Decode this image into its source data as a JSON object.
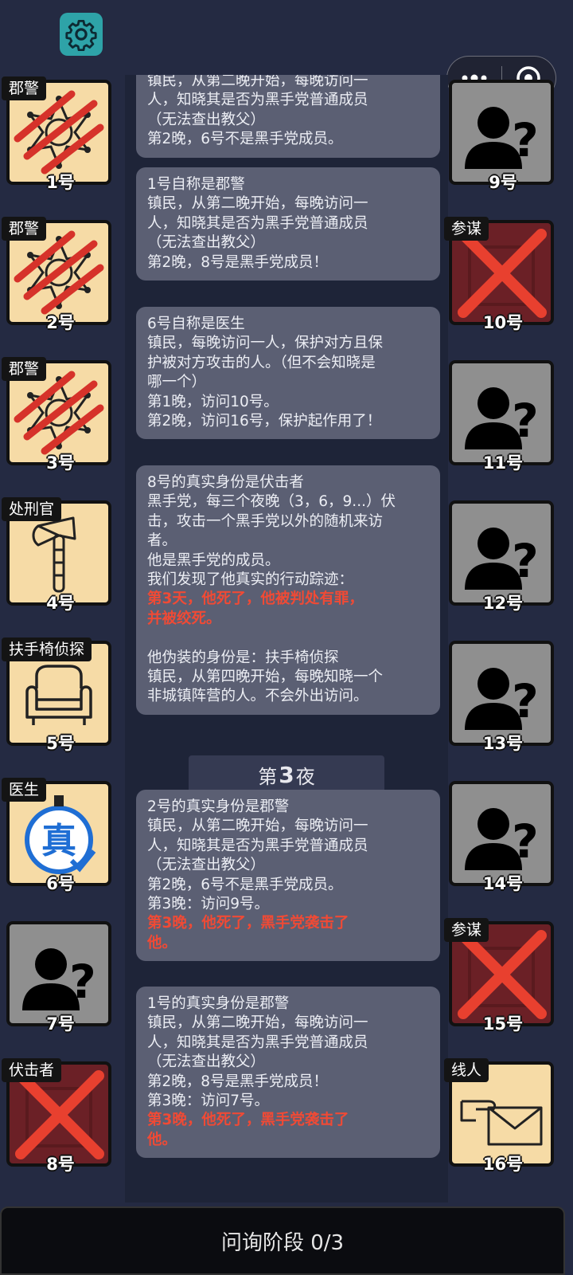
{
  "phase_label": "问询阶段 0/3",
  "night_header": {
    "prefix": "第",
    "number": "3",
    "suffix": "夜"
  },
  "left_players": [
    {
      "num": "1号",
      "role": "郡警",
      "state": "dead",
      "icon": "sheriff-badge-icon"
    },
    {
      "num": "2号",
      "role": "郡警",
      "state": "dead",
      "icon": "sheriff-badge-icon"
    },
    {
      "num": "3号",
      "role": "郡警",
      "state": "dead",
      "icon": "sheriff-badge-icon"
    },
    {
      "num": "4号",
      "role": "处刑官",
      "state": "alive",
      "icon": "axe-icon"
    },
    {
      "num": "5号",
      "role": "扶手椅侦探",
      "state": "alive",
      "icon": "armchair-icon"
    },
    {
      "num": "6号",
      "role": "医生",
      "state": "alive",
      "icon": "true-identity-stamp-icon"
    },
    {
      "num": "7号",
      "role": "",
      "state": "unknown",
      "icon": "unknown-person-icon"
    },
    {
      "num": "8号",
      "role": "伏击者",
      "state": "eliminated",
      "icon": "x-mark-icon"
    }
  ],
  "right_players": [
    {
      "num": "9号",
      "role": "",
      "state": "unknown",
      "icon": "unknown-person-icon"
    },
    {
      "num": "10号",
      "role": "参谋",
      "state": "eliminated",
      "icon": "x-mark-icon"
    },
    {
      "num": "11号",
      "role": "",
      "state": "unknown",
      "icon": "unknown-person-icon"
    },
    {
      "num": "12号",
      "role": "",
      "state": "unknown",
      "icon": "unknown-person-icon"
    },
    {
      "num": "13号",
      "role": "",
      "state": "unknown",
      "icon": "unknown-person-icon"
    },
    {
      "num": "14号",
      "role": "",
      "state": "unknown",
      "icon": "unknown-person-icon"
    },
    {
      "num": "15号",
      "role": "参谋",
      "state": "eliminated",
      "icon": "x-mark-icon"
    },
    {
      "num": "16号",
      "role": "线人",
      "state": "alive",
      "icon": "envelope-hand-icon"
    }
  ],
  "log_cards": [
    {
      "lines": [
        {
          "t": "镇民，从第二晚开始，每晚访问一",
          "red": false
        },
        {
          "t": "人，知晓其是否为黑手党普通成员",
          "red": false
        },
        {
          "t": "（无法查出教父）",
          "red": false
        },
        {
          "t": "第2晚，6号不是黑手党成员。",
          "red": false
        }
      ]
    },
    {
      "lines": [
        {
          "t": "1号自称是郡警",
          "red": false
        },
        {
          "t": "镇民，从第二晚开始，每晚访问一",
          "red": false
        },
        {
          "t": "人，知晓其是否为黑手党普通成员",
          "red": false
        },
        {
          "t": "（无法查出教父）",
          "red": false
        },
        {
          "t": "第2晚，8号是黑手党成员！",
          "red": false
        }
      ]
    },
    {
      "lines": [
        {
          "t": "6号自称是医生",
          "red": false
        },
        {
          "t": "镇民，每晚访问一人，保护对方且保",
          "red": false
        },
        {
          "t": "护被对方攻击的人。（但不会知晓是",
          "red": false
        },
        {
          "t": "哪一个）",
          "red": false
        },
        {
          "t": "第1晚，访问10号。",
          "red": false
        },
        {
          "t": "第2晚，访问16号，保护起作用了！",
          "red": false
        }
      ]
    },
    {
      "lines": [
        {
          "t": "8号的真实身份是伏击者",
          "red": false
        },
        {
          "t": "黑手党，每三个夜晚（3，6，9...）伏",
          "red": false
        },
        {
          "t": "击，攻击一个黑手党以外的随机来访",
          "red": false
        },
        {
          "t": "者。",
          "red": false
        },
        {
          "t": "他是黑手党的成员。",
          "red": false
        },
        {
          "t": "我们发现了他真实的行动踪迹：",
          "red": false
        },
        {
          "t": "第3天，他死了，他被判处有罪，",
          "red": true
        },
        {
          "t": "并被绞死。",
          "red": true
        },
        {
          "t": " ",
          "red": false
        },
        {
          "t": "他伪装的身份是：扶手椅侦探",
          "red": false
        },
        {
          "t": "镇民，从第四晚开始，每晚知晓一个",
          "red": false
        },
        {
          "t": "非城镇阵营的人。不会外出访问。",
          "red": false
        }
      ]
    },
    {
      "lines": [
        {
          "t": "2号的真实身份是郡警",
          "red": false
        },
        {
          "t": "镇民，从第二晚开始，每晚访问一",
          "red": false
        },
        {
          "t": "人，知晓其是否为黑手党普通成员",
          "red": false
        },
        {
          "t": "（无法查出教父）",
          "red": false
        },
        {
          "t": "第2晚，6号不是黑手党成员。",
          "red": false
        },
        {
          "t": "第3晚：访问9号。",
          "red": false
        },
        {
          "t": "第3晚，他死了，黑手党袭击了",
          "red": true
        },
        {
          "t": "他。",
          "red": true
        }
      ]
    },
    {
      "lines": [
        {
          "t": "1号的真实身份是郡警",
          "red": false
        },
        {
          "t": "镇民，从第二晚开始，每晚访问一",
          "red": false
        },
        {
          "t": "人，知晓其是否为黑手党普通成员",
          "red": false
        },
        {
          "t": "（无法查出教父）",
          "red": false
        },
        {
          "t": "第2晚，8号是黑手党成员！",
          "red": false
        },
        {
          "t": "第3晚：访问7号。",
          "red": false
        },
        {
          "t": "第3晚，他死了，黑手党袭击了",
          "red": true
        },
        {
          "t": "他。",
          "red": true
        }
      ]
    }
  ]
}
